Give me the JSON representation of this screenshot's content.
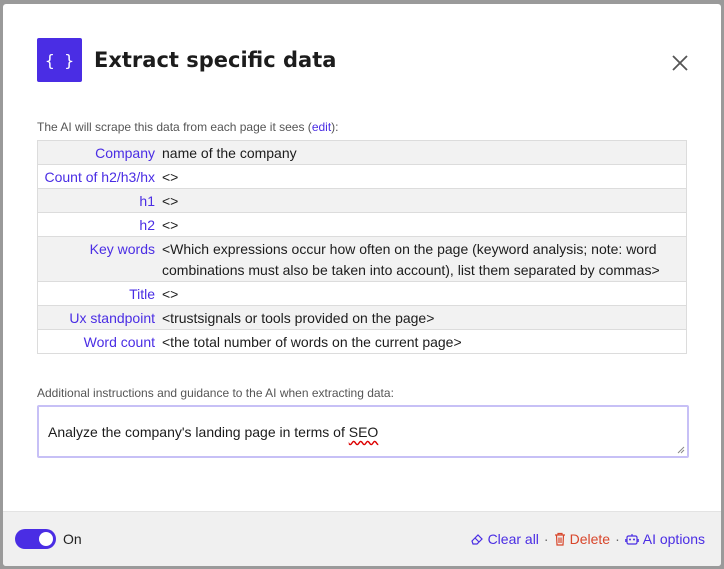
{
  "dialog": {
    "logo_glyph": "{ }",
    "title": "Extract specific data"
  },
  "intro": {
    "prefix": "The AI will scrape this data from each page it sees (",
    "link": "edit",
    "suffix": "):"
  },
  "fields": [
    {
      "key": "Company",
      "value": "name of the company"
    },
    {
      "key": "Count of h2/h3/hx",
      "value": "<>"
    },
    {
      "key": "h1",
      "value": "<>"
    },
    {
      "key": "h2",
      "value": "<>"
    },
    {
      "key": "Key words",
      "value": "<Which expressions occur how often on the page (keyword analysis; note: word combinations must also be taken into account), list them separated by commas>"
    },
    {
      "key": "Title",
      "value": "<>"
    },
    {
      "key": "Ux standpoint",
      "value": "<trustsignals or tools provided on the page>"
    },
    {
      "key": "Word count",
      "value": "<the total number of words on the current page>"
    }
  ],
  "guidance": {
    "label": "Additional instructions and guidance to the AI when extracting data:",
    "value_prefix": "Analyze the company's landing page in terms of ",
    "value_flagged": "SEO"
  },
  "footer": {
    "toggle_state": "on",
    "toggle_label": "On",
    "clear_label": "Clear all",
    "delete_label": "Delete",
    "ai_options_label": "AI options",
    "separator": "·"
  },
  "colors": {
    "accent": "#4a2de4",
    "danger": "#d8462b"
  }
}
